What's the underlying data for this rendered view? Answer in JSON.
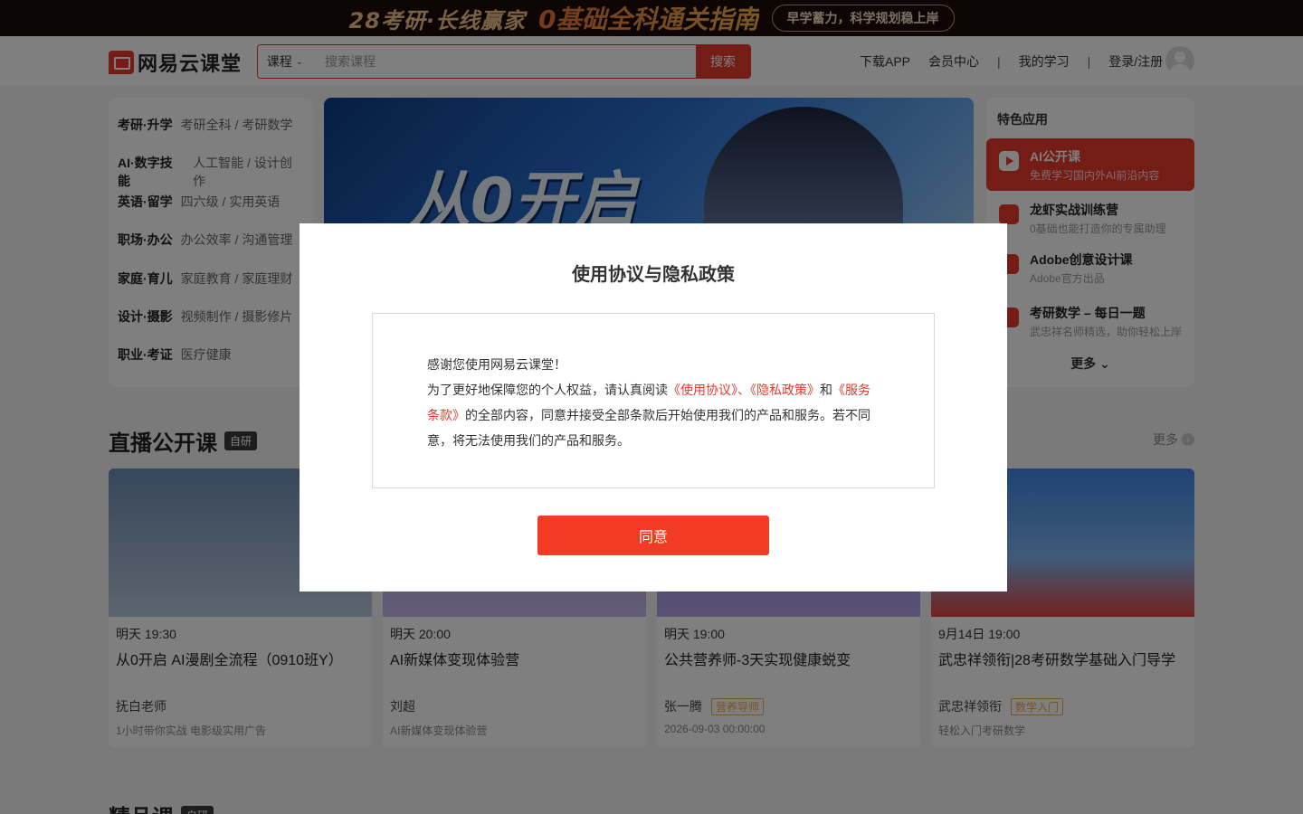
{
  "top_banner": {
    "left": "28考研·长线赢家",
    "middle": "0基础全科通关指南",
    "pill": "早学蓄力，科学规划稳上岸"
  },
  "header": {
    "logo": "网易云课堂",
    "search": {
      "category": "课程",
      "placeholder": "搜索课程",
      "button": "搜索"
    },
    "nav": [
      "下载APP",
      "会员中心",
      "我的学习",
      "登录/注册"
    ],
    "nav_separator": "|"
  },
  "categories": [
    {
      "main": "考研·升学",
      "sub": "考研全科 / 考研数学"
    },
    {
      "main": "AI·数字技能",
      "sub": "人工智能 / 设计创作"
    },
    {
      "main": "英语·留学",
      "sub": "四六级 / 实用英语"
    },
    {
      "main": "职场·办公",
      "sub": "办公效率 / 沟通管理"
    },
    {
      "main": "家庭·育儿",
      "sub": "家庭教育 / 家庭理财"
    },
    {
      "main": "设计·摄影",
      "sub": "视频制作 / 摄影修片"
    },
    {
      "main": "职业·考证",
      "sub": "医疗健康"
    }
  ],
  "hero": {
    "title": "从0开启"
  },
  "features": {
    "title": "特色应用",
    "items": [
      {
        "title": "AI公开课",
        "desc": "免费学习国内外AI前沿内容"
      },
      {
        "title": "龙虾实战训练营",
        "desc": "0基础也能打造你的专属助理"
      },
      {
        "title": "Adobe创意设计课",
        "desc": "Adobe官方出品"
      },
      {
        "title": "考研数学 – 每日一题",
        "desc": "武忠祥名师精选，助你轻松上岸"
      }
    ],
    "more": "更多"
  },
  "live": {
    "title": "直播公开课",
    "tag": "自研",
    "more": "更多",
    "cards": [
      {
        "time": "明天 19:30",
        "title": "从0开启 AI漫剧全流程（0910班Y）",
        "teacher": "抚白老师",
        "badge": "",
        "desc": "1小时带你实战 电影级实用广告"
      },
      {
        "time": "明天 20:00",
        "title": "AI新媒体变现体验营",
        "teacher": "刘超",
        "badge": "",
        "desc": "AI新媒体变现体验营"
      },
      {
        "time": "明天 19:00",
        "title": "公共营养师-3天实现健康蜕变",
        "teacher": "张一腾",
        "badge": "营养导师",
        "desc": "2026-09-03 00:00:00"
      },
      {
        "time": "9月14日 19:00",
        "title": "武忠祥领衔|28考研数学基础入门导学",
        "teacher": "武忠祥领衔",
        "badge": "数学入门",
        "desc": "轻松入门考研数学"
      }
    ]
  },
  "section2": {
    "title": "精品课",
    "tag": "自研"
  },
  "modal": {
    "title": "使用协议与隐私政策",
    "line1": "感谢您使用网易云课堂！",
    "p_before": "为了更好地保障您的个人权益，请认真阅读",
    "link1": "《使用协议》",
    "sep1": "、",
    "link2": "《隐私政策》",
    "and": "和",
    "link3": "《服务条款》",
    "p_after": "的全部内容，同意并接受全部条款后开始使用我们的产品和服务。若不同意，将无法使用我们的产品和服务。",
    "agree": "同意"
  }
}
